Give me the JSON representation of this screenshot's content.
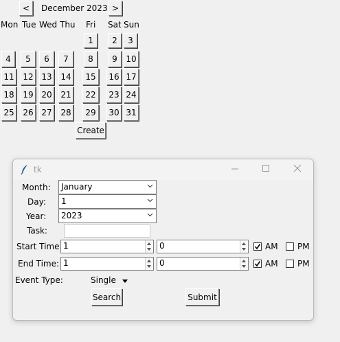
{
  "calendar": {
    "prev_label": "<",
    "next_label": ">",
    "month_label": "December 2023",
    "weekdays": [
      "Mon",
      "Tue",
      "Wed",
      "Thu",
      "Fri",
      "Sat",
      "Sun"
    ],
    "create_label": "Create",
    "days": [
      "1",
      "2",
      "3",
      "4",
      "5",
      "6",
      "7",
      "8",
      "9",
      "10",
      "11",
      "12",
      "13",
      "14",
      "15",
      "16",
      "17",
      "18",
      "19",
      "20",
      "21",
      "22",
      "23",
      "24",
      "25",
      "26",
      "27",
      "28",
      "29",
      "30",
      "31"
    ]
  },
  "dialog": {
    "title": "tk",
    "month_label": "Month:",
    "month_value": "January",
    "day_label": "Day:",
    "day_value": "1",
    "year_label": "Year:",
    "year_value": "2023",
    "task_label": "Task:",
    "task_value": "",
    "start_time_label": "Start Time:",
    "start_hour": "1",
    "start_minute": "0",
    "start_am_label": "AM",
    "start_am_checked": true,
    "start_pm_label": "PM",
    "start_pm_checked": false,
    "end_time_label": "End Time:",
    "end_hour": "1",
    "end_minute": "0",
    "end_am_label": "AM",
    "end_am_checked": true,
    "end_pm_label": "PM",
    "end_pm_checked": false,
    "event_type_label": "Event Type:",
    "event_type_value": "Single",
    "search_label": "Search",
    "submit_label": "Submit"
  }
}
